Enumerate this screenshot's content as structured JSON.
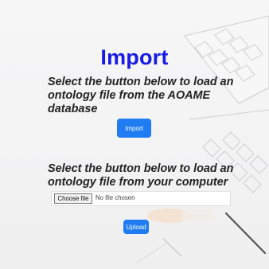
{
  "title": "Import",
  "sections": [
    {
      "instruction": "Select the button below to load an ontology file from the AOAME database",
      "button_label": "Import"
    },
    {
      "instruction": "Select the button below to load an ontology file from your computer",
      "file_input": {
        "choose_label": "Choose file",
        "status": "No file chosen"
      },
      "button_label": "Upload"
    }
  ],
  "colors": {
    "title": "#1a1ae6",
    "button": "#1f7cf2"
  }
}
